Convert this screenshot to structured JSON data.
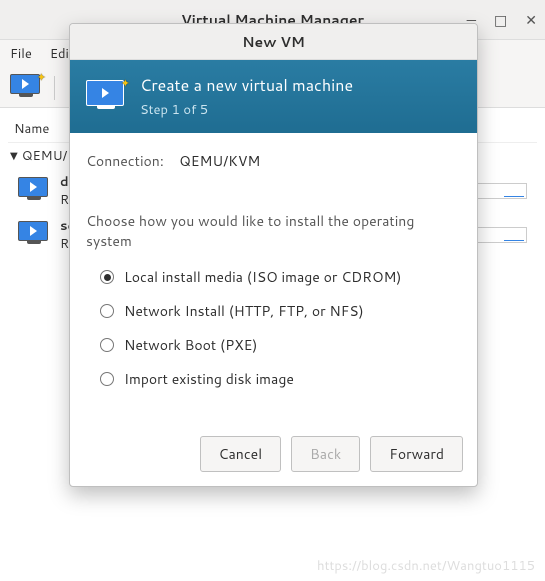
{
  "window": {
    "title": "Virtual Machine Manager"
  },
  "menubar": {
    "file": "File",
    "edit": "Edit"
  },
  "columns": {
    "name": "Name"
  },
  "host": {
    "label": "QEMU/K"
  },
  "vms": [
    {
      "name": "de",
      "status": "Ru"
    },
    {
      "name": "se",
      "status": "Ru"
    }
  ],
  "dialog": {
    "title": "New VM",
    "banner": {
      "heading": "Create a new virtual machine",
      "step": "Step 1 of 5"
    },
    "connection_label": "Connection:",
    "connection_value": "QEMU/KVM",
    "prompt": "Choose how you would like to install the operating system",
    "options": [
      {
        "label": "Local install media (ISO image or CDROM)",
        "selected": true
      },
      {
        "label": "Network Install (HTTP, FTP, or NFS)",
        "selected": false
      },
      {
        "label": "Network Boot (PXE)",
        "selected": false
      },
      {
        "label": "Import existing disk image",
        "selected": false
      }
    ],
    "buttons": {
      "cancel": "Cancel",
      "back": "Back",
      "forward": "Forward"
    }
  },
  "watermark": "https://blog.csdn.net/Wangtuo1115"
}
